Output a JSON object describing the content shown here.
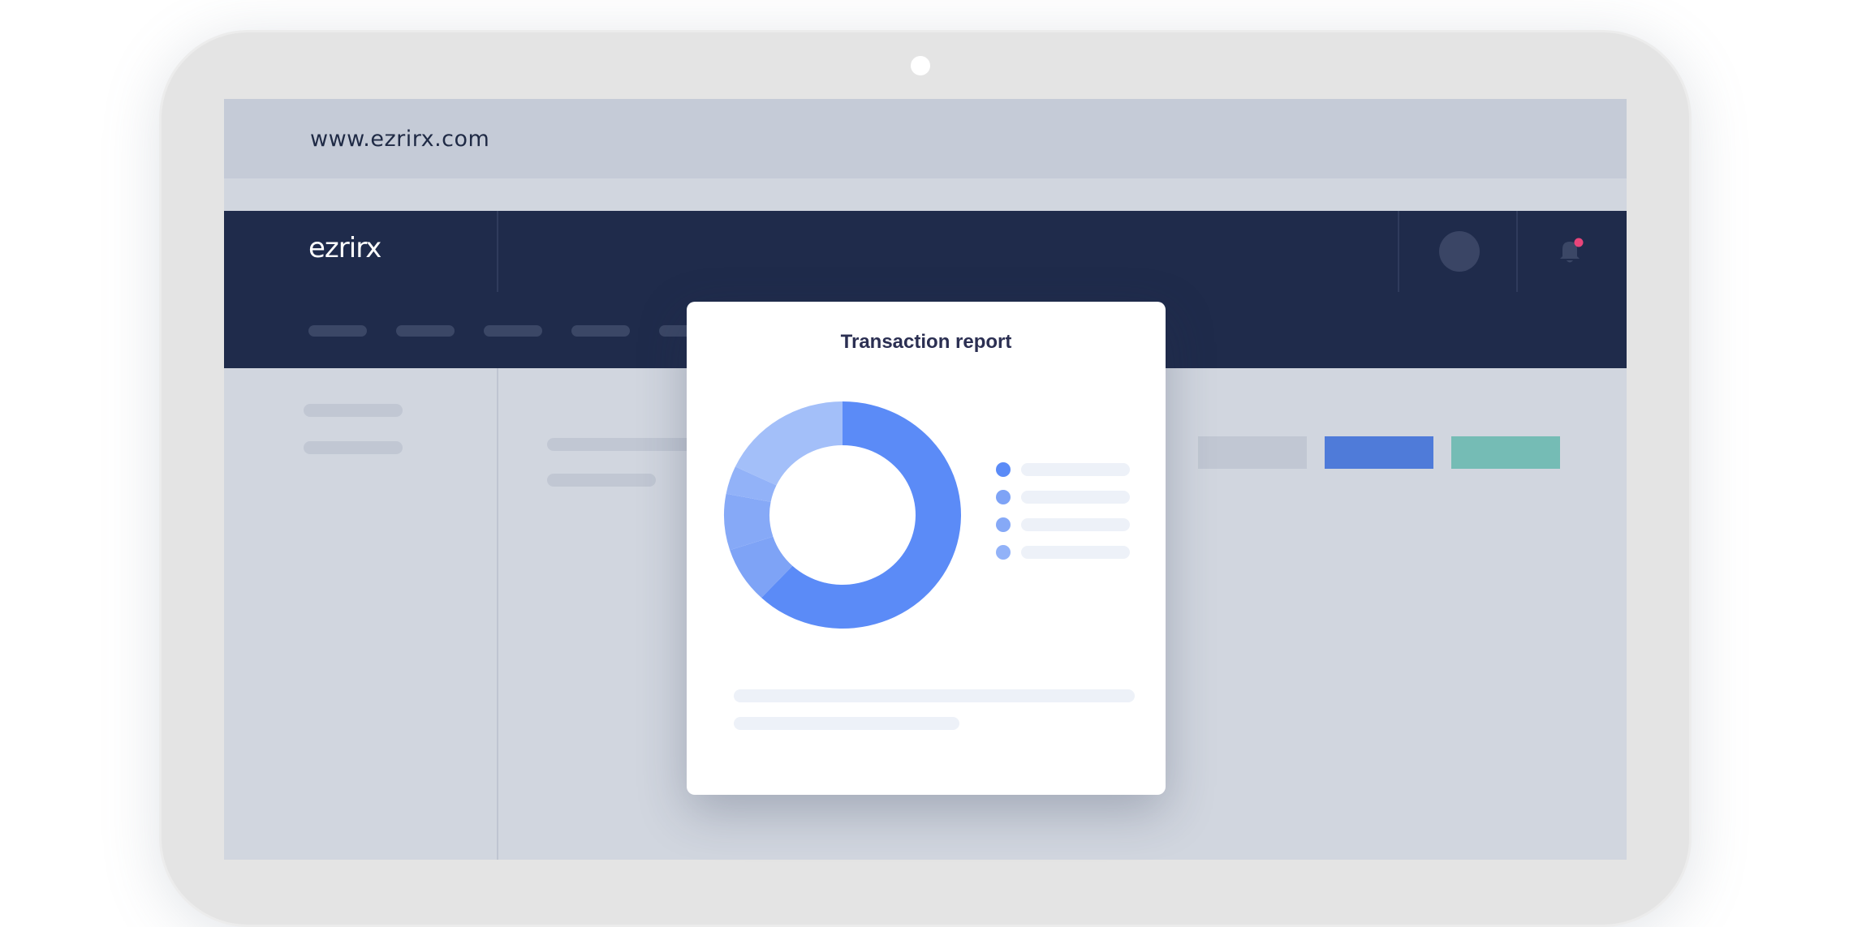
{
  "browser": {
    "url": "www.ezrirx.com"
  },
  "app": {
    "logo_text": "ezrirx"
  },
  "modal": {
    "title": "Transaction report"
  },
  "colors": {
    "navy": "#1f2b4b",
    "primary_button": "#4f7bd9",
    "secondary_button": "#75bcb5",
    "neutral_button": "#c1c7d3",
    "notification_dot": "#e8457a"
  },
  "chart_data": {
    "type": "pie",
    "values": [
      62,
      8,
      8,
      4,
      18
    ],
    "colors": [
      "#5b8bf7",
      "#7ea3f6",
      "#86a9f7",
      "#92b2f8",
      "#a3bff9"
    ]
  },
  "icons": [
    "bell-icon",
    "avatar"
  ]
}
